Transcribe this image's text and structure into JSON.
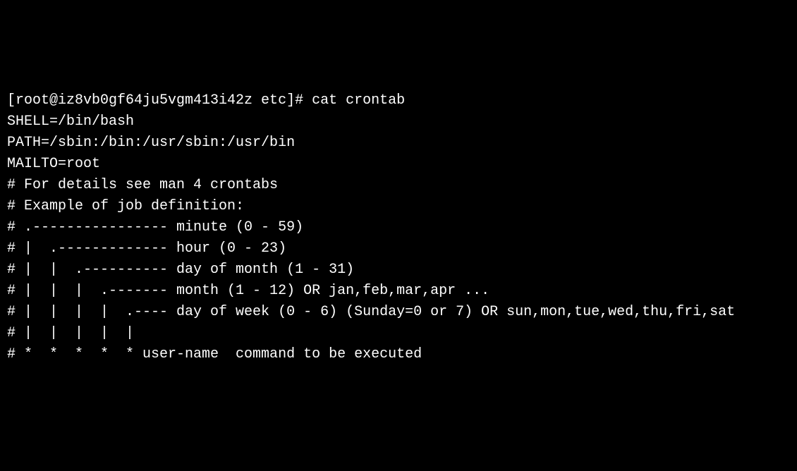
{
  "terminal": {
    "prompt": "[root@iz8vb0gf64ju5vgm413i42z etc]# ",
    "command": "cat crontab",
    "output": {
      "line1": "SHELL=/bin/bash",
      "line2": "PATH=/sbin:/bin:/usr/sbin:/usr/bin",
      "line3": "MAILTO=root",
      "line4": "",
      "line5": "# For details see man 4 crontabs",
      "line6": "",
      "line7": "# Example of job definition:",
      "line8": "# .---------------- minute (0 - 59)",
      "line9": "# |  .------------- hour (0 - 23)",
      "line10": "# |  |  .---------- day of month (1 - 31)",
      "line11": "# |  |  |  .------- month (1 - 12) OR jan,feb,mar,apr ...",
      "line12": "# |  |  |  |  .---- day of week (0 - 6) (Sunday=0 or 7) OR sun,mon,tue,wed,thu,fri,sat",
      "line13": "# |  |  |  |  |",
      "line14": "# *  *  *  *  * user-name  command to be executed"
    }
  }
}
